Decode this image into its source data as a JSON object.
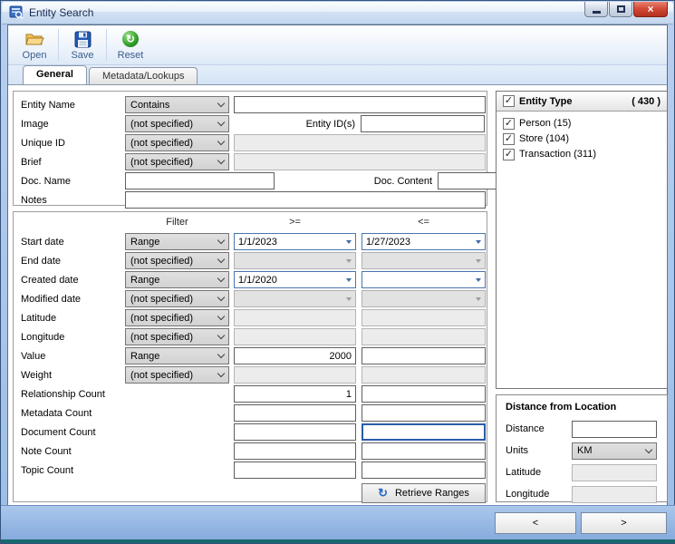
{
  "window": {
    "title": "Entity Search"
  },
  "toolbar": {
    "open": "Open",
    "save": "Save",
    "reset": "Reset"
  },
  "tabs": [
    {
      "label": "General",
      "active": true
    },
    {
      "label": "Metadata/Lookups",
      "active": false
    }
  ],
  "entity_form": {
    "entity_name": {
      "label": "Entity Name",
      "filter": "Contains",
      "value": ""
    },
    "image": {
      "label": "Image",
      "filter": "(not specified)"
    },
    "entity_ids": {
      "label": "Entity ID(s)",
      "value": ""
    },
    "unique_id": {
      "label": "Unique ID",
      "filter": "(not specified)"
    },
    "brief": {
      "label": "Brief",
      "filter": "(not specified)"
    },
    "doc_name": {
      "label": "Doc. Name",
      "value": ""
    },
    "doc_content": {
      "label": "Doc. Content",
      "value": ""
    },
    "notes": {
      "label": "Notes",
      "value": ""
    }
  },
  "filter_section": {
    "headers": {
      "filter": "Filter",
      "gte": ">=",
      "lte": "<="
    },
    "rows": [
      {
        "label": "Start date",
        "filter": "Range",
        "kind": "date",
        "enabled": true,
        "min": "1/1/2023",
        "max": "1/27/2023"
      },
      {
        "label": "End date",
        "filter": "(not specified)",
        "kind": "date",
        "enabled": false,
        "min": "",
        "max": ""
      },
      {
        "label": "Created date",
        "filter": "Range",
        "kind": "date",
        "enabled": true,
        "min": "1/1/2020",
        "max": ""
      },
      {
        "label": "Modified date",
        "filter": "(not specified)",
        "kind": "date",
        "enabled": false,
        "min": "",
        "max": ""
      },
      {
        "label": "Latitude",
        "filter": "(not specified)",
        "kind": "num",
        "enabled": false,
        "min": "",
        "max": ""
      },
      {
        "label": "Longitude",
        "filter": "(not specified)",
        "kind": "num",
        "enabled": false,
        "min": "",
        "max": ""
      },
      {
        "label": "Value",
        "filter": "Range",
        "kind": "num",
        "enabled": true,
        "min": "2000",
        "max": ""
      },
      {
        "label": "Weight",
        "filter": "(not specified)",
        "kind": "num",
        "enabled": false,
        "min": "",
        "max": ""
      },
      {
        "label": "Relationship Count",
        "filter": null,
        "kind": "num",
        "enabled": true,
        "min": "1",
        "max": ""
      },
      {
        "label": "Metadata Count",
        "filter": null,
        "kind": "num",
        "enabled": true,
        "min": "",
        "max": ""
      },
      {
        "label": "Document Count",
        "filter": null,
        "kind": "num",
        "enabled": true,
        "min": "",
        "max": "",
        "focused": "max"
      },
      {
        "label": "Note Count",
        "filter": null,
        "kind": "num",
        "enabled": true,
        "min": "",
        "max": ""
      },
      {
        "label": "Topic Count",
        "filter": null,
        "kind": "num",
        "enabled": true,
        "min": "",
        "max": ""
      }
    ],
    "retrieve_label": "Retrieve Ranges"
  },
  "entity_type": {
    "title": "Entity Type",
    "count": "( 430 )",
    "header_checked": true,
    "items": [
      {
        "label": "Person (15)",
        "checked": true
      },
      {
        "label": "Store (104)",
        "checked": true
      },
      {
        "label": "Transaction (311)",
        "checked": true
      }
    ]
  },
  "distance_panel": {
    "title": "Distance from Location",
    "distance": {
      "label": "Distance",
      "value": ""
    },
    "units": {
      "label": "Units",
      "value": "KM"
    },
    "latitude": {
      "label": "Latitude",
      "value": "",
      "disabled": true
    },
    "longitude": {
      "label": "Longitude",
      "value": "",
      "disabled": true
    }
  },
  "footer": {
    "prev": "<",
    "next": ">"
  },
  "colors": {
    "titlebar_text": "#1b2c50",
    "frame": "#9cbde6",
    "teal_strip": "#17696d",
    "close_button": "#d14836",
    "focus_border": "#2a5caa",
    "refresh_icon": "#2468c8"
  }
}
